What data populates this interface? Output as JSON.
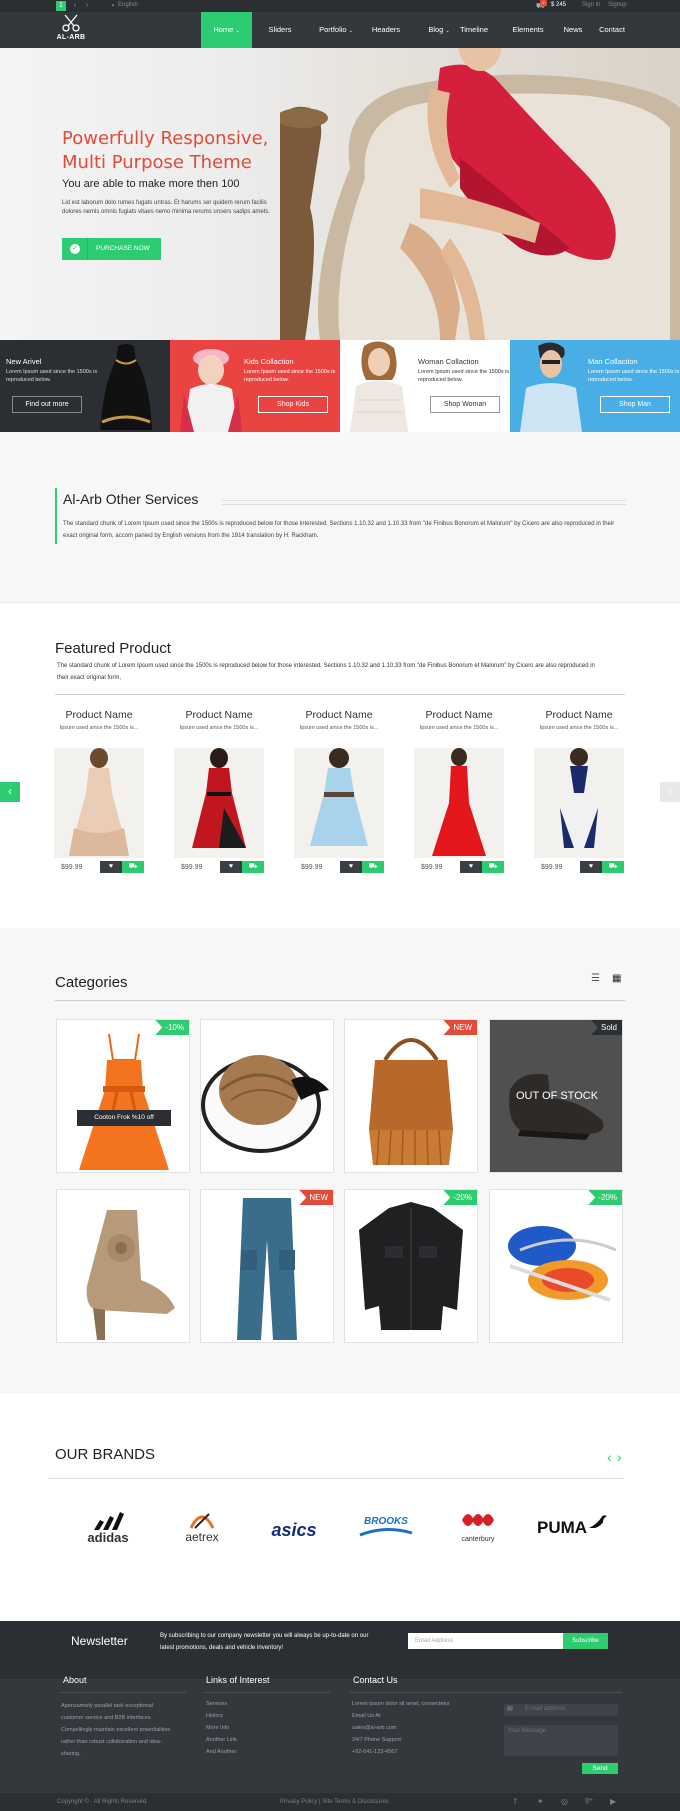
{
  "topbar": {
    "page_number": "1",
    "language": "English",
    "cart_count": "2",
    "cart_total": "$ 245",
    "signin": "Sign in",
    "signup": "Signup"
  },
  "logo": {
    "text": "AL-ARB"
  },
  "nav": [
    "Home",
    "Sliders",
    "Portfolio",
    "Headers",
    "Blog",
    "Timeline",
    "Elements",
    "News",
    "Contact"
  ],
  "hero": {
    "title_line1": "Powerfully Responsive,",
    "title_line2": "Multi Purpose Theme",
    "subtitle": "You are able to make more then 100",
    "body": "Lid est laborum dolo rumes fugats untras. Et harums ser quidem rerum facilis dolores nemis omnis fugiats vitaes nemo minima rerums unsers sadips amets.",
    "button": "PURCHASE NOW"
  },
  "collections": [
    {
      "title": "New Arivel",
      "desc": "Lorem Ipsum used since the 1500s is reproduced below.",
      "button": "Find out more"
    },
    {
      "title": "Kids Collaction",
      "desc": "Lorem Ipsum used since the 1500s is reproduced below.",
      "button": "Shop Kids"
    },
    {
      "title": "Woman Collaction",
      "desc": "Lorem Ipsum used since the 1500s is reproduced below.",
      "button": "Shop Woman"
    },
    {
      "title": "Man Collaction",
      "desc": "Lorem Ipsum used since the 1500s is reproduced below.",
      "button": "Shop Man"
    }
  ],
  "services": {
    "title": "Al-Arb Other Services",
    "text": "The standard chunk of Lorem Ipsum used since the 1500s is reproduced below for those interested. Sections 1.10.32 and 1.10.33 from \"de Finibus Bonorum et Malorum\" by Cicero are also reproduced in their exact original form, accom panied by English versions from the 1914 translation by H. Rackham."
  },
  "featured": {
    "title": "Featured Product",
    "text": "The standard chunk of Lorem Ipsum used since the 1500s is reproduced below for those interested. Sections 1.10.32 and 1.10.33 from \"de Finibus Bonorum et Malorum\" by Cicero are also reproduced in their exact original form,",
    "products": [
      {
        "name": "Product Name",
        "desc": "Ipsum used since the 1500s is...",
        "price": "$99.99"
      },
      {
        "name": "Product Name",
        "desc": "Ipsum used since the 1500s is...",
        "price": "$99.99"
      },
      {
        "name": "Product Name",
        "desc": "Ipsum used since the 1500s is...",
        "price": "$99.99"
      },
      {
        "name": "Product Name",
        "desc": "Ipsum used since the 1500s is...",
        "price": "$99.99"
      },
      {
        "name": "Product Name",
        "desc": "Ipsum used since the 1500s is...",
        "price": "$99.99"
      }
    ]
  },
  "categories": {
    "title": "Categories",
    "items": [
      {
        "badge": "-10%",
        "caption": "Cooton Frok %10 off"
      },
      {
        "badge": "",
        "caption": ""
      },
      {
        "badge": "NEW",
        "caption": ""
      },
      {
        "badge": "Sold",
        "caption": "OUT OF STOCK"
      },
      {
        "badge": "",
        "caption": ""
      },
      {
        "badge": "NEW",
        "caption": ""
      },
      {
        "badge": "-20%",
        "caption": ""
      },
      {
        "badge": "-20%",
        "caption": ""
      }
    ]
  },
  "brands": {
    "title": "OUR BRANDS",
    "items": [
      "adidas",
      "aetrex",
      "asics",
      "BROOKS",
      "canterbury",
      "PUMA"
    ]
  },
  "newsletter": {
    "title": "Newsletter",
    "text": "By subscribing to our company newsletter you will always be up-to-date on our latest promotions, deals and vehicle inventory!",
    "placeholder": "Email Address",
    "button": "Subscribe"
  },
  "footer": {
    "about_title": "About",
    "about_text": "Apenzamtely parallel task exceptional customer service and B2B interfaces Compellingly maintain excellent potentialities rather than robust collaboration and idea-sharing.",
    "links_title": "Links of Interest",
    "links": [
      "Services",
      "History",
      "More Info",
      "Another Link",
      "And Another"
    ],
    "contact_title": "Contact Us",
    "contact_lines": [
      "Lorem ipsum dolor sit amet, consectetur",
      "Email Us At",
      "sales@al-arb.com",
      "24/7 Phone Support",
      "+92-041-123-4567"
    ],
    "form_email_placeholder": "E-mail address",
    "form_message_placeholder": "Your Message",
    "form_send": "Send"
  },
  "bottombar": {
    "copyright": "Copyright ©  · All Rights Reserved",
    "policy": "Privacy Policy | Site Terms & Disclosures"
  },
  "colors": {
    "accent": "#2ecc71",
    "red": "#e04b3a",
    "dark": "#33383d",
    "blue": "#4aaee6"
  }
}
